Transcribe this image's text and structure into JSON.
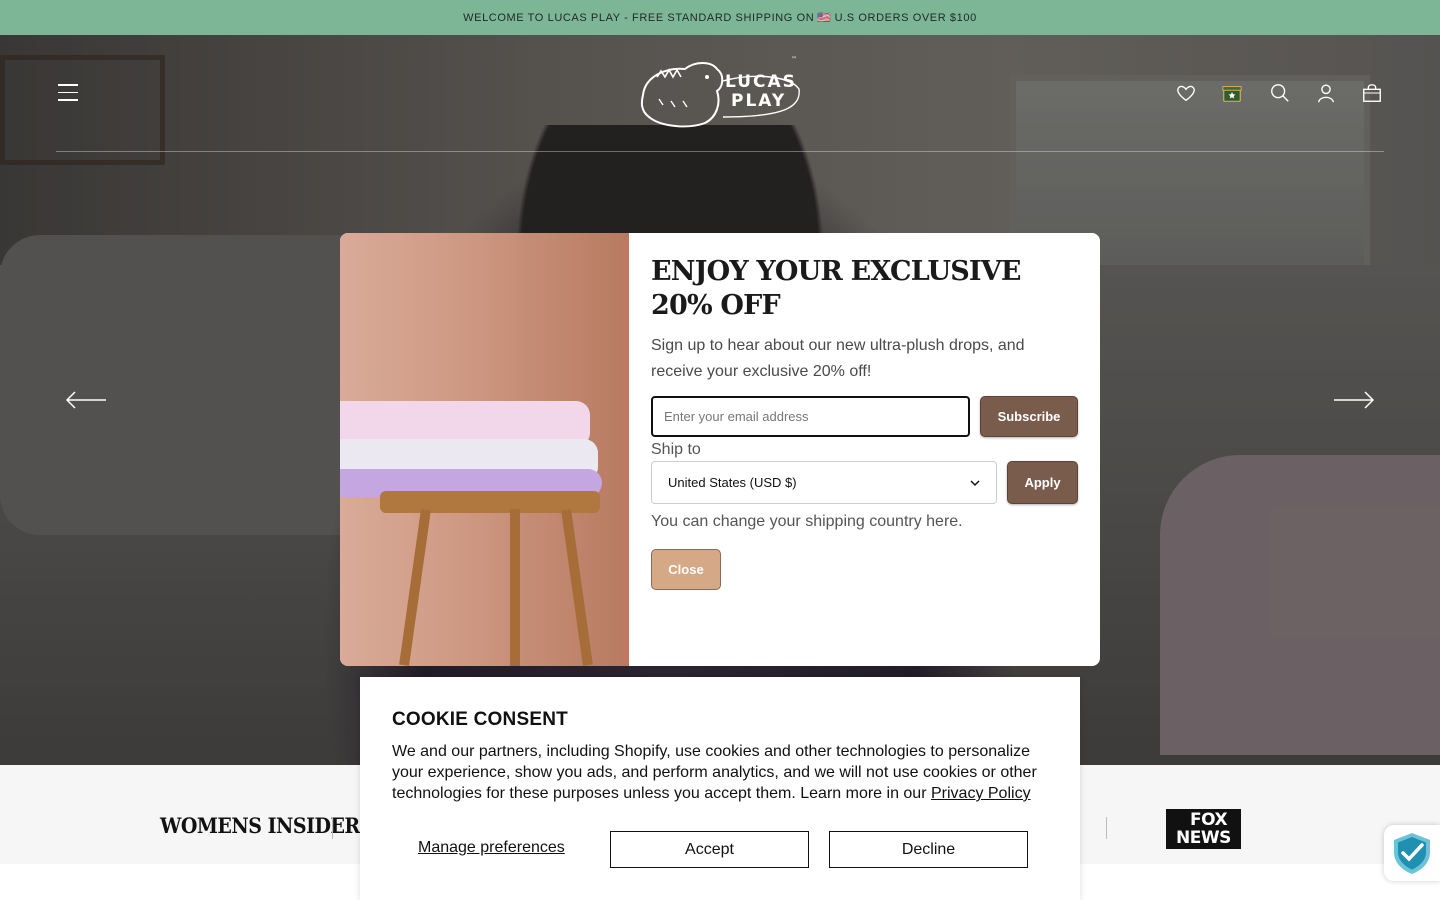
{
  "announcement": {
    "text_before_flag": "WELCOME TO LUCAS PLAY - FREE STANDARD SHIPPING ON",
    "flag": "🇺🇸",
    "text_after_flag": "U.S ORDERS OVER $100"
  },
  "header": {
    "logo_text_line1": "LUCAS",
    "logo_text_line2": "PLAY",
    "icons": [
      "wishlist-heart-icon",
      "rewards-gift-icon",
      "search-icon",
      "account-icon",
      "cart-bag-icon"
    ]
  },
  "hero": {
    "prev_icon": "arrow-left-icon",
    "next_icon": "arrow-right-icon"
  },
  "popup": {
    "title": "ENJOY YOUR EXCLUSIVE 20% OFF",
    "description": "Sign up to hear about our new ultra-plush drops, and receive your exclusive 20% off!",
    "email_placeholder": "Enter your email address",
    "subscribe_label": "Subscribe",
    "ship_to_label": "Ship to",
    "country_selected": "United States (USD $)",
    "apply_label": "Apply",
    "note": "You can change your shipping country here.",
    "close_label": "Close"
  },
  "press": {
    "left_logo": "WOMENS INSIDER",
    "right_logo_line1": "FOX",
    "right_logo_line2": "NEWS"
  },
  "cookie": {
    "title": "COOKIE CONSENT",
    "text": "We and our partners, including Shopify, use cookies and other technologies to personalize your experience, show you ads, and perform analytics, and we will not use cookies or other technologies for these purposes unless you accept them. Learn more in our",
    "link": "Privacy Policy",
    "manage": "Manage preferences",
    "accept": "Accept",
    "decline": "Decline"
  },
  "colors": {
    "announcement_bg": "#7db597",
    "brand_button": "#7a5c4d",
    "close_button": "#d5a985"
  }
}
